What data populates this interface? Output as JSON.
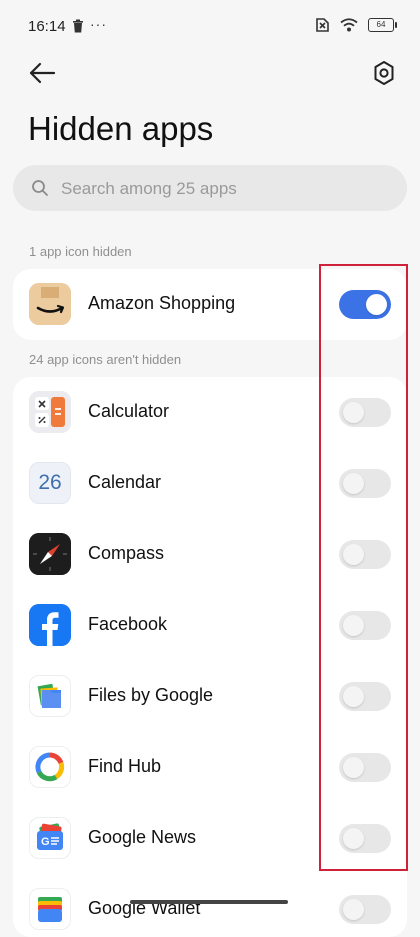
{
  "status_bar": {
    "time": "16:14",
    "more": "···",
    "battery": "64"
  },
  "header": {
    "title": "Hidden apps"
  },
  "search": {
    "placeholder": "Search among 25 apps"
  },
  "hidden_section": {
    "label": "1 app icon hidden",
    "apps": [
      {
        "name": "Amazon Shopping",
        "hidden": true
      }
    ]
  },
  "visible_section": {
    "label": "24 app icons aren't hidden",
    "apps": [
      {
        "name": "Calculator",
        "hidden": false
      },
      {
        "name": "Calendar",
        "hidden": false,
        "icon_text": "26"
      },
      {
        "name": "Compass",
        "hidden": false
      },
      {
        "name": "Facebook",
        "hidden": false
      },
      {
        "name": "Files by Google",
        "hidden": false
      },
      {
        "name": "Find Hub",
        "hidden": false
      },
      {
        "name": "Google News",
        "hidden": false
      },
      {
        "name": "Google Wallet",
        "hidden": false
      }
    ]
  },
  "colors": {
    "toggle_on": "#3b73e6",
    "toggle_off": "#e7e7e7",
    "highlight": "#d0213a"
  }
}
